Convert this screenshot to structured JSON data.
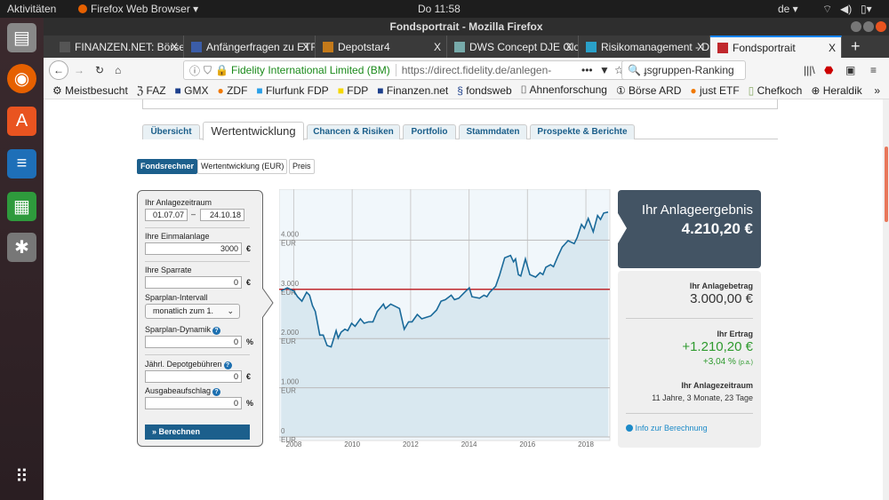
{
  "system": {
    "activities": "Aktivitäten",
    "app_menu": "Firefox Web Browser ▾",
    "clock": "Do 11:58",
    "lang": "de ▾"
  },
  "window": {
    "title": "Fondsportrait - Mozilla Firefox"
  },
  "tabs": [
    {
      "label": "FINANZEN.NET: Börse",
      "color": "#555"
    },
    {
      "label": "Anfängerfragen zu ETF",
      "color": "#3b5da8"
    },
    {
      "label": "Depotstar4",
      "color": "#c47a1a"
    },
    {
      "label": "DWS Concept DJE Glob",
      "color": "#7aa"
    },
    {
      "label": "Risikomanagement - D",
      "color": "#2aa0c8"
    },
    {
      "label": "Fondsportrait",
      "color": "#c0282d",
      "active": true
    }
  ],
  "nav": {
    "site_identity": "Fidelity International Limited (BM)",
    "url": "https://direct.fidelity.de/anlegen-",
    "search_value": "ɟsgruppen-Ranking"
  },
  "bookmarks": [
    "Meistbesucht",
    "FAZ",
    "GMX",
    "ZDF",
    "Flurfunk FDP",
    "FDP",
    "Finanzen.net",
    "fondsweb",
    "Ahnenforschung",
    "Börse ARD",
    "just ETF",
    "Chefkoch",
    "Heraldik"
  ],
  "page_tabs": [
    "Übersicht",
    "Wertentwicklung",
    "Chancen & Risiken",
    "Portfolio",
    "Stammdaten",
    "Prospekte & Berichte"
  ],
  "sub_tabs": [
    "Fondsrechner",
    "Wertentwicklung (EUR)",
    "Preis"
  ],
  "form": {
    "period_label": "Ihr Anlagezeitraum",
    "from": "01.07.07",
    "dash": "–",
    "to": "24.10.18",
    "lump_label": "Ihre Einmalanlage",
    "lump": "3000",
    "eur": "€",
    "rate_label": "Ihre Sparrate",
    "rate": "0",
    "interval_label": "Sparplan-Intervall",
    "interval": "monatlich zum 1.",
    "dyn_label": "Sparplan-Dynamik",
    "dyn": "0",
    "pct": "%",
    "fee_label": "Jährl. Depotgebühren",
    "fee": "0",
    "agio_label": "Ausgabeaufschlag",
    "agio": "0",
    "calc_button": "Berechnen"
  },
  "result": {
    "title": "Ihr Anlageergebnis",
    "value": "4.210,20 €",
    "amount_label": "Ihr Anlagebetrag",
    "amount": "3.000,00 €",
    "yield_label": "Ihr Ertrag",
    "yield": "+1.210,20 €",
    "yield_pct": "+3,04 %",
    "pa": "(p.a.)",
    "period_label": "Ihr Anlagezeitraum",
    "period": "11 Jahre, 3 Monate, 23 Tage",
    "info_link": "Info zur Berechnung",
    "positive_color": "#2e9a2e"
  },
  "chart_data": {
    "type": "area",
    "xlim": [
      2007.5,
      2018.82
    ],
    "ylim": [
      0,
      5000
    ],
    "x_ticks": [
      "2008",
      "2010",
      "2012",
      "2014",
      "2016",
      "2018"
    ],
    "y_ticks": [
      {
        "v": 0,
        "label": "0",
        "unit": "EUR"
      },
      {
        "v": 1000,
        "label": "1.000",
        "unit": "EUR"
      },
      {
        "v": 2000,
        "label": "2.000",
        "unit": "EUR"
      },
      {
        "v": 3000,
        "label": "3.000",
        "unit": "EUR"
      },
      {
        "v": 4000,
        "label": "4.000",
        "unit": "EUR"
      }
    ],
    "reference_line": 3000,
    "reference_color": "#c0282d",
    "line_color": "#1a6a9a",
    "grid": true,
    "points": [
      [
        2007.57,
        2970
      ],
      [
        2007.78,
        3030
      ],
      [
        2008.0,
        2970
      ],
      [
        2008.13,
        2850
      ],
      [
        2008.28,
        2760
      ],
      [
        2008.44,
        2940
      ],
      [
        2008.54,
        2880
      ],
      [
        2008.64,
        2670
      ],
      [
        2008.74,
        2550
      ],
      [
        2008.89,
        2070
      ],
      [
        2009.01,
        2070
      ],
      [
        2009.14,
        1860
      ],
      [
        2009.28,
        1830
      ],
      [
        2009.45,
        2160
      ],
      [
        2009.52,
        2010
      ],
      [
        2009.62,
        2130
      ],
      [
        2009.75,
        2190
      ],
      [
        2009.85,
        2160
      ],
      [
        2009.98,
        2310
      ],
      [
        2010.1,
        2250
      ],
      [
        2010.28,
        2400
      ],
      [
        2010.41,
        2310
      ],
      [
        2010.56,
        2340
      ],
      [
        2010.71,
        2340
      ],
      [
        2010.86,
        2550
      ],
      [
        2011.07,
        2700
      ],
      [
        2011.14,
        2610
      ],
      [
        2011.32,
        2700
      ],
      [
        2011.52,
        2640
      ],
      [
        2011.62,
        2610
      ],
      [
        2011.78,
        2190
      ],
      [
        2011.93,
        2340
      ],
      [
        2012.05,
        2340
      ],
      [
        2012.23,
        2490
      ],
      [
        2012.38,
        2400
      ],
      [
        2012.53,
        2430
      ],
      [
        2012.69,
        2460
      ],
      [
        2012.89,
        2580
      ],
      [
        2013.04,
        2760
      ],
      [
        2013.19,
        2790
      ],
      [
        2013.39,
        2880
      ],
      [
        2013.5,
        2790
      ],
      [
        2013.65,
        2820
      ],
      [
        2013.85,
        2940
      ],
      [
        2014.01,
        3030
      ],
      [
        2014.1,
        2850
      ],
      [
        2014.36,
        2820
      ],
      [
        2014.51,
        2880
      ],
      [
        2014.61,
        2850
      ],
      [
        2014.71,
        2940
      ],
      [
        2014.91,
        3060
      ],
      [
        2015.04,
        3280
      ],
      [
        2015.22,
        3640
      ],
      [
        2015.42,
        3690
      ],
      [
        2015.52,
        3560
      ],
      [
        2015.59,
        3620
      ],
      [
        2015.69,
        3300
      ],
      [
        2015.77,
        3270
      ],
      [
        2015.93,
        3620
      ],
      [
        2016.08,
        3300
      ],
      [
        2016.28,
        3250
      ],
      [
        2016.43,
        3340
      ],
      [
        2016.53,
        3300
      ],
      [
        2016.63,
        3450
      ],
      [
        2016.79,
        3500
      ],
      [
        2016.89,
        3460
      ],
      [
        2017.04,
        3670
      ],
      [
        2017.19,
        3860
      ],
      [
        2017.39,
        3990
      ],
      [
        2017.6,
        3930
      ],
      [
        2017.7,
        4050
      ],
      [
        2017.85,
        4320
      ],
      [
        2017.95,
        4240
      ],
      [
        2018.08,
        4440
      ],
      [
        2018.25,
        4170
      ],
      [
        2018.4,
        4500
      ],
      [
        2018.5,
        4420
      ],
      [
        2018.61,
        4550
      ],
      [
        2018.76,
        4570
      ]
    ]
  }
}
